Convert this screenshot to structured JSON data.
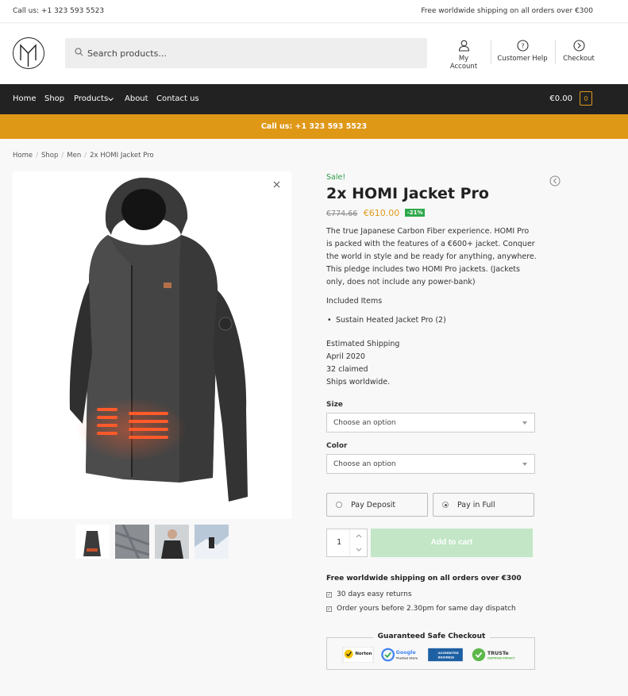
{
  "topbar": {
    "phone": "Call us: +1 323 593 5523",
    "shipping": "Free worldwide shipping on all orders over €300"
  },
  "header": {
    "search_placeholder": "Search products...",
    "links": [
      "My Account",
      "Customer Help",
      "Checkout"
    ]
  },
  "nav": {
    "items": [
      "Home",
      "Shop",
      "Products",
      "About",
      "Contact us"
    ],
    "cart_total": "€0.00",
    "cart_count": "0"
  },
  "promo": "Call us: +1 323 593 5523",
  "breadcrumb": [
    "Home",
    "Shop",
    "Men",
    "2x HOMI Jacket Pro"
  ],
  "product": {
    "sale_label": "Sale!",
    "title": "2x HOMI Jacket Pro",
    "old_price": "€774.66",
    "new_price": "€610.00",
    "discount": "-21%",
    "description": "The true Japanese Carbon Fiber experience. HOMI Pro is packed with the features of a €600+ jacket. Conquer the world in style and be ready for anything, anywhere. This pledge includes two HOMI Pro jackets. (Jackets only, does not include any power-bank)",
    "included_label": "Included Items",
    "included_items": [
      "Sustain Heated Jacket Pro (2)"
    ],
    "shipping_lines": [
      "Estimated Shipping",
      "April 2020",
      "32 claimed",
      "Ships worldwide."
    ]
  },
  "form": {
    "size_label": "Size",
    "size_value": "Choose an option",
    "color_label": "Color",
    "color_value": "Choose an option",
    "pay_deposit": "Pay Deposit",
    "pay_full": "Pay in Full",
    "quantity": "1",
    "add_to_cart": "Add to cart"
  },
  "perks": {
    "headline": "Free worldwide shipping on all orders over €300",
    "items": [
      "30 days easy returns",
      "Order yours before 2.30pm for same day dispatch"
    ]
  },
  "safe_checkout": {
    "title": "Guaranteed Safe Checkout",
    "seals": [
      "Norton",
      "Google Trusted Store",
      "Accredited Business",
      "TRUSTe"
    ]
  },
  "colors": {
    "accent": "#df9716",
    "nav_bg": "#222222",
    "sale_green": "#2e9b47",
    "cart_button": "#c2e6c6"
  }
}
